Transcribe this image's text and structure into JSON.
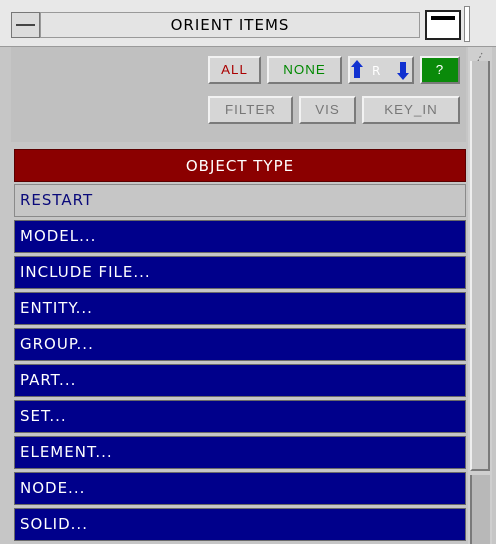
{
  "window": {
    "title": "ORIENT ITEMS"
  },
  "toolbar": {
    "all_label": "ALL",
    "none_label": "NONE",
    "swap_letter": "R",
    "help_label": "?",
    "filter_label": "FILTER",
    "vis_label": "VIS",
    "key_in_label": "KEY_IN"
  },
  "list": {
    "header": "OBJECT TYPE",
    "items": [
      {
        "label": "RESTART"
      },
      {
        "label": "MODEL..."
      },
      {
        "label": "INCLUDE FILE..."
      },
      {
        "label": "ENTITY..."
      },
      {
        "label": "GROUP..."
      },
      {
        "label": "PART..."
      },
      {
        "label": "SET..."
      },
      {
        "label": "ELEMENT..."
      },
      {
        "label": "NODE..."
      },
      {
        "label": "SOLID..."
      }
    ]
  },
  "colors": {
    "all_text": "#aa0000",
    "none_text": "#008800",
    "help_bg": "#0a8a0a",
    "header_bg": "#8b0000",
    "item_bg": "#00008b",
    "selected_bg": "#c6c6c6",
    "selected_text": "#0a0a7a"
  },
  "icons": {
    "minimize": "minimize-icon",
    "maximize": "maximize-icon",
    "swap": "swap-arrows-icon"
  }
}
